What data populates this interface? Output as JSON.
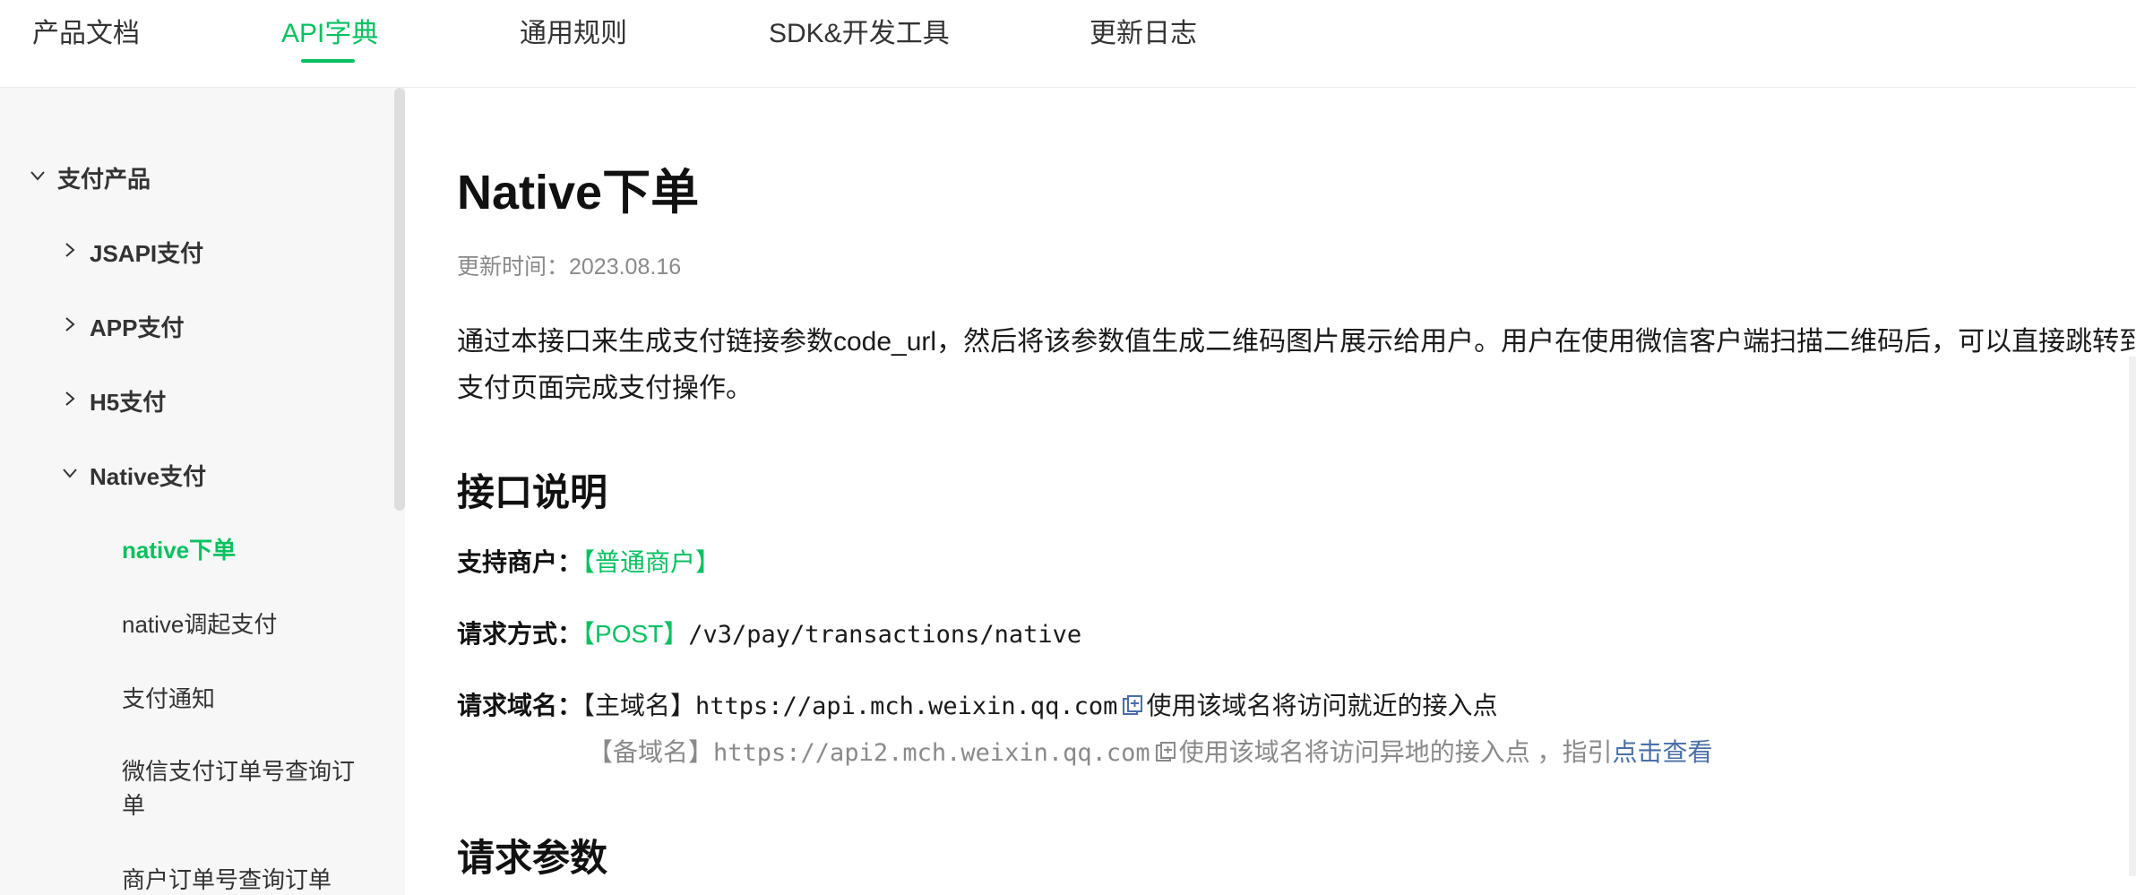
{
  "nav": {
    "tabs": [
      {
        "label": "产品文档"
      },
      {
        "label": "API字典"
      },
      {
        "label": "通用规则"
      },
      {
        "label": "SDK&开发工具"
      },
      {
        "label": "更新日志"
      }
    ],
    "active_index": 1
  },
  "sidebar": {
    "items": [
      {
        "label": "支付产品",
        "expanded": true
      },
      {
        "label": "JSAPI支付",
        "expanded": false
      },
      {
        "label": "APP支付",
        "expanded": false
      },
      {
        "label": "H5支付",
        "expanded": false
      },
      {
        "label": "Native支付",
        "expanded": true
      },
      {
        "label": "native下单",
        "selected": true
      },
      {
        "label": "native调起支付"
      },
      {
        "label": "支付通知"
      },
      {
        "label_line1": "微信支付订单号查询订",
        "label_line2": "单"
      },
      {
        "label": "商户订单号查询订单"
      }
    ]
  },
  "content": {
    "title": "Native下单",
    "update_time": "更新时间：2023.08.16",
    "description_line1": "通过本接口来生成支付链接参数code_url，然后将该参数值生成二维码图片展示给用户。用户在使用微信客户端扫描二维码后，可以直接跳转到微信",
    "description_line2": "支付页面完成支付操作。",
    "section_interface": "接口说明",
    "merchant_label": "支持商户：",
    "merchant_value": "【普通商户】",
    "method_label": "请求方式：",
    "method_value": "【POST】",
    "method_path": "/v3/pay/transactions/native",
    "domain_label": "请求域名：",
    "primary_tag": "【主域名】",
    "primary_url": "https://api.mch.weixin.qq.com",
    "primary_note": "使用该域名将访问就近的接入点",
    "backup_tag": "【备域名】",
    "backup_url": "https://api2.mch.weixin.qq.com",
    "backup_note": "使用该域名将访问异地的接入点 ，指引",
    "backup_link": "点击查看",
    "section_params": "请求参数"
  },
  "colors": {
    "accent": "#07c160",
    "link": "#4a6fa5",
    "muted": "#8a8a8a"
  }
}
